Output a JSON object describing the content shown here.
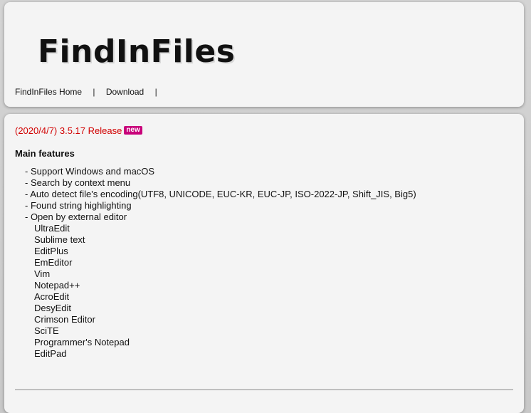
{
  "header": {
    "title": "FindInFiles",
    "nav": [
      {
        "label": "FindInFiles Home"
      },
      {
        "label": "Download"
      }
    ],
    "separator": "|"
  },
  "release": {
    "text": "(2020/4/7) 3.5.17 Release",
    "badge": "new"
  },
  "features": {
    "heading": "Main features",
    "items": [
      "- Support Windows and macOS",
      "- Search by context menu",
      "- Auto detect file's encoding(UTF8, UNICODE, EUC-KR, EUC-JP, ISO-2022-JP, Shift_JIS, Big5)",
      "- Found string highlighting",
      "- Open by external editor"
    ],
    "editors": [
      "UltraEdit",
      "Sublime text",
      "EditPlus",
      "EmEditor",
      "Vim",
      "Notepad++",
      "AcroEdit",
      "DesyEdit",
      "Crimson Editor",
      "SciTE",
      "Programmer's Notepad",
      "EditPad"
    ]
  },
  "colors": {
    "release_red": "#d10000",
    "badge_magenta": "#c8007a"
  }
}
